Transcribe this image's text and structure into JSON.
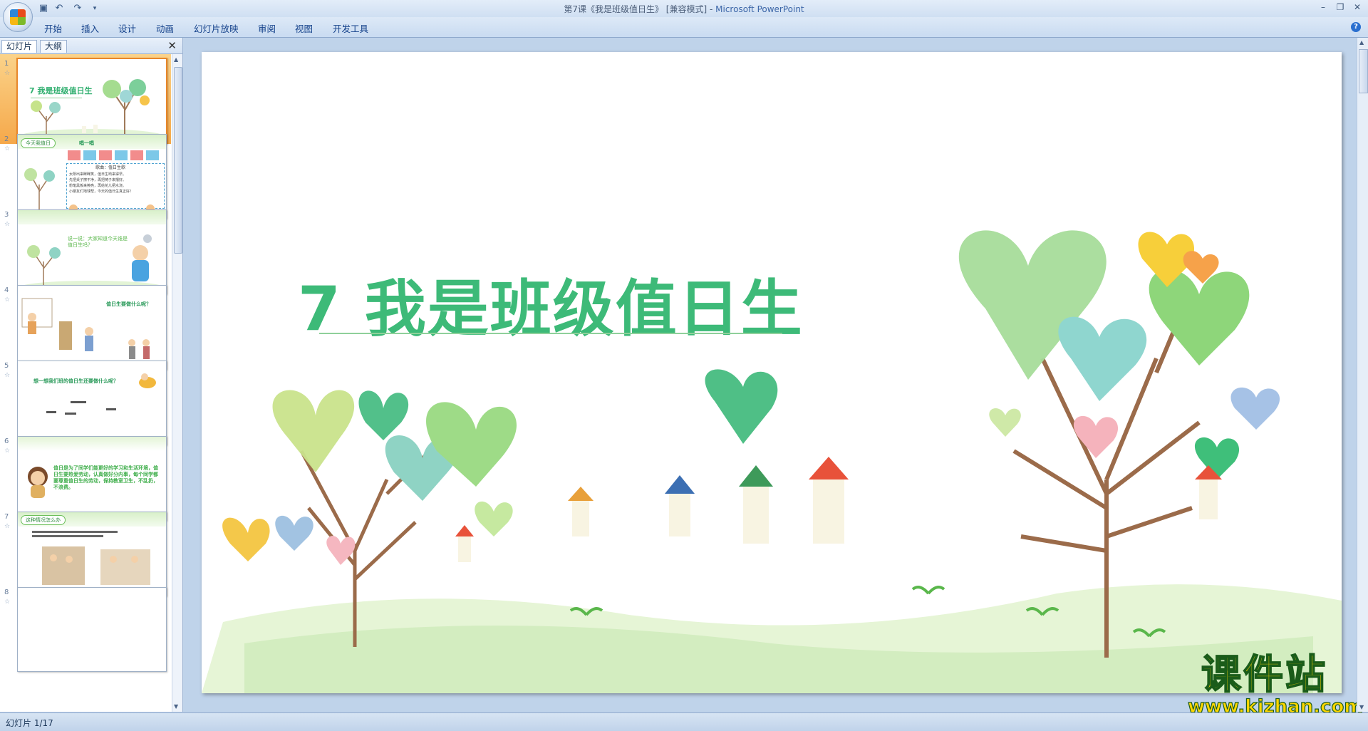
{
  "window": {
    "title": "第7课《我是班级值日生》 [兼容模式] - ",
    "app_name": "Microsoft PowerPoint"
  },
  "quick_access": [
    "save-icon",
    "undo-icon",
    "redo-icon",
    "customize-icon"
  ],
  "ribbon": {
    "tabs": [
      {
        "label": "开始"
      },
      {
        "label": "插入"
      },
      {
        "label": "设计"
      },
      {
        "label": "动画"
      },
      {
        "label": "幻灯片放映"
      },
      {
        "label": "审阅"
      },
      {
        "label": "视图"
      },
      {
        "label": "开发工具"
      }
    ]
  },
  "panel": {
    "tabs": [
      {
        "label": "幻灯片"
      },
      {
        "label": "大纲"
      }
    ],
    "close_label": "✕"
  },
  "thumbnails": [
    {
      "num": "1",
      "star": "☆",
      "title": "7 我是班级值日生"
    },
    {
      "num": "2",
      "star": "☆",
      "pill": "今天我值日",
      "heading": "唱一唱",
      "song_title": "歌曲：值日生歌",
      "lines": [
        "太阳出来眯眯笑，值日生哟来得早。",
        "先把桌子擦干净，再把椅子来摆好。",
        "粉笔黑板来擦亮，再给花儿把水浇。",
        "小朋友们地球帮，今天的值日生真正好！"
      ]
    },
    {
      "num": "3",
      "star": "☆",
      "text": "说一说：大家知道今天谁是值日生吗？"
    },
    {
      "num": "4",
      "star": "☆",
      "heading": "值日生要做什么呢？"
    },
    {
      "num": "5",
      "star": "☆",
      "heading": "想一想我们班的值日生还要做什么呢？"
    },
    {
      "num": "6",
      "star": "☆",
      "text": "值日是为了同学们能更好的学习和生活环境，值日生要热爱劳动，认真做好分内事，每个同学都要尊重值日生的劳动，保持教室卫生，不乱扔，不浪费。"
    },
    {
      "num": "7",
      "star": "☆",
      "pill": "这种情况怎么办"
    },
    {
      "num": "8",
      "star": "☆"
    }
  ],
  "slide": {
    "title": "7 我是班级值日生"
  },
  "watermark": {
    "cn": "课件站",
    "url": "www.kjzhan.com"
  },
  "status": {
    "text": "幻灯片 1/17"
  }
}
